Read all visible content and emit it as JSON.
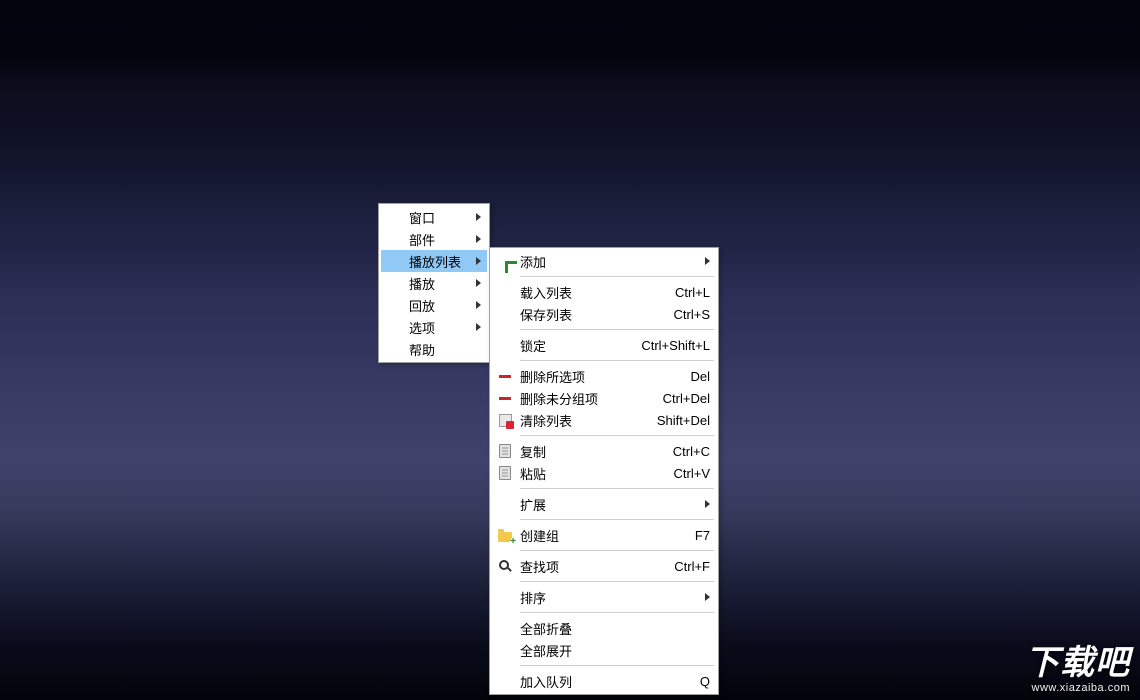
{
  "menu1": {
    "items": [
      {
        "label": "窗口",
        "hasSubmenu": true
      },
      {
        "label": "部件",
        "hasSubmenu": true
      },
      {
        "label": "播放列表",
        "hasSubmenu": true,
        "highlight": true
      },
      {
        "label": "播放",
        "hasSubmenu": true
      },
      {
        "label": "回放",
        "hasSubmenu": true
      },
      {
        "label": "选项",
        "hasSubmenu": true
      },
      {
        "label": "帮助",
        "hasSubmenu": false
      }
    ]
  },
  "menu2": {
    "groups": [
      [
        {
          "icon": "plus-icon",
          "label": "添加",
          "hasSubmenu": true
        }
      ],
      [
        {
          "label": "载入列表",
          "shortcut": "Ctrl+L"
        },
        {
          "label": "保存列表",
          "shortcut": "Ctrl+S"
        }
      ],
      [
        {
          "label": "锁定",
          "shortcut": "Ctrl+Shift+L"
        }
      ],
      [
        {
          "icon": "minus-icon",
          "label": "删除所选项",
          "shortcut": "Del"
        },
        {
          "icon": "minus-icon",
          "label": "删除未分组项",
          "shortcut": "Ctrl+Del"
        },
        {
          "icon": "clearlist-icon",
          "label": "清除列表",
          "shortcut": "Shift+Del"
        }
      ],
      [
        {
          "icon": "copy-icon",
          "label": "复制",
          "shortcut": "Ctrl+C"
        },
        {
          "icon": "paste-icon",
          "label": "粘贴",
          "shortcut": "Ctrl+V"
        }
      ],
      [
        {
          "label": "扩展",
          "hasSubmenu": true
        }
      ],
      [
        {
          "icon": "folder-plus-icon",
          "label": "创建组",
          "shortcut": "F7"
        }
      ],
      [
        {
          "icon": "search-icon",
          "label": "查找项",
          "shortcut": "Ctrl+F"
        }
      ],
      [
        {
          "label": "排序",
          "hasSubmenu": true
        }
      ],
      [
        {
          "label": "全部折叠"
        },
        {
          "label": "全部展开"
        }
      ],
      [
        {
          "label": "加入队列",
          "shortcut": "Q"
        }
      ]
    ]
  },
  "watermark": {
    "big": "下载吧",
    "small": "www.xiazaiba.com"
  }
}
